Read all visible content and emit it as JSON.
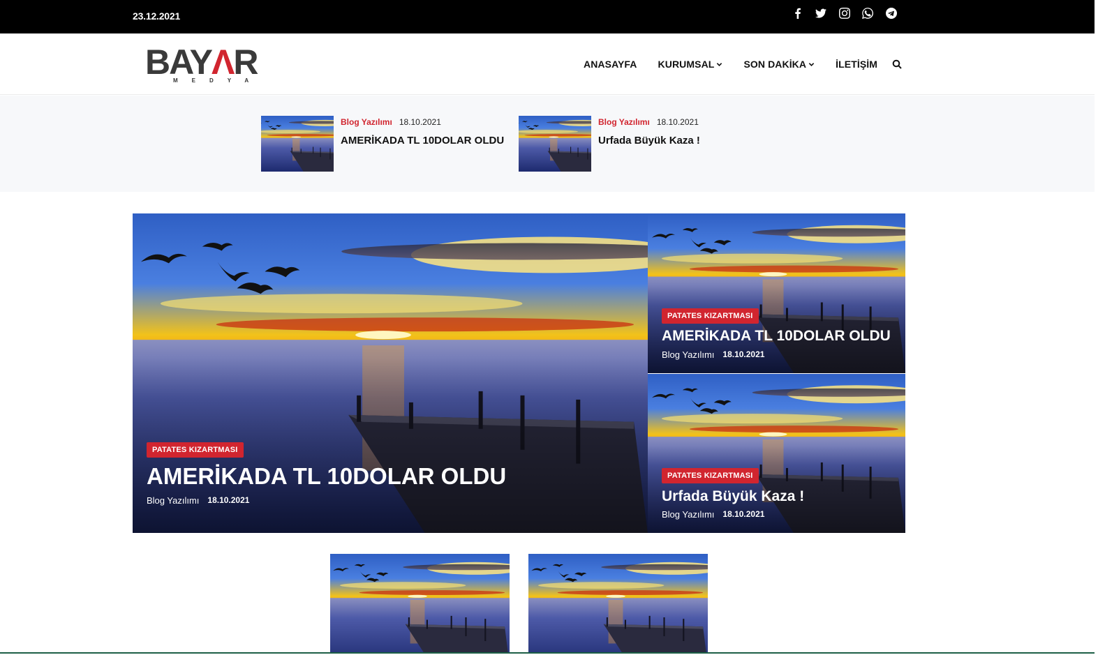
{
  "topbar": {
    "date": "23.12.2021",
    "social": [
      {
        "icon": "facebook-icon"
      },
      {
        "icon": "twitter-icon"
      },
      {
        "icon": "instagram-icon"
      },
      {
        "icon": "whatsapp-icon"
      },
      {
        "icon": "telegram-icon"
      }
    ]
  },
  "header": {
    "logo_main_left": "BAY",
    "logo_main_red": "Λ",
    "logo_main_right": "R",
    "logo_sub": "MEDYA",
    "nav": [
      {
        "label": "ANASAYFA"
      },
      {
        "label": "KURUMSAL",
        "has_dropdown": true
      },
      {
        "label": "SON DAKİKA",
        "has_dropdown": true
      },
      {
        "label": "İLETİŞİM"
      }
    ]
  },
  "strip": {
    "items": [
      {
        "category": "Blog Yazılımı",
        "date": "18.10.2021",
        "title": "AMERİKADA TL 10DOLAR OLDU"
      },
      {
        "category": "Blog Yazılımı",
        "date": "18.10.2021",
        "title": "Urfada Büyük Kaza !"
      }
    ]
  },
  "featured": {
    "main": {
      "badge": "PATATES KIZARTMASI",
      "title": "AMERİKADA TL 10DOLAR OLDU",
      "category": "Blog Yazılımı",
      "date": "18.10.2021"
    },
    "side": [
      {
        "badge": "PATATES KIZARTMASI",
        "title": "AMERİKADA TL 10DOLAR OLDU",
        "category": "Blog Yazılımı",
        "date": "18.10.2021"
      },
      {
        "badge": "PATATES KIZARTMASI",
        "title": "Urfada Büyük Kaza !",
        "category": "Blog Yazılımı",
        "date": "18.10.2021"
      }
    ]
  },
  "colors": {
    "accent": "#d1252f",
    "topbar": "#000000",
    "strip_bg": "#f7f8fa"
  }
}
